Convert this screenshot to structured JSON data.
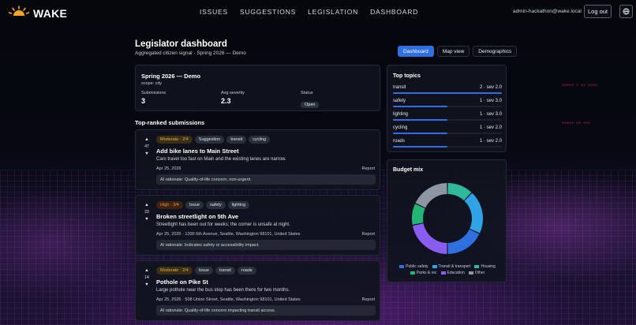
{
  "brand": {
    "name": "WAKE"
  },
  "nav": {
    "issues": "ISSUES",
    "suggestions": "SUGGESTIONS",
    "legislation": "LEGISLATION",
    "dashboard": "DASHBOARD"
  },
  "user": {
    "email": "admin-hackathon@wake.local",
    "logout_label": "Log out"
  },
  "page": {
    "title": "Legislator dashboard",
    "subtitle": "Aggregated citizen signal · Spring 2026 — Demo"
  },
  "view_tabs": [
    "Dashboard",
    "Map view",
    "Demographics"
  ],
  "active_tab": "Dashboard",
  "summary": {
    "title": "Spring 2026 — Demo",
    "scope": "scope: city",
    "submissions_label": "Submissions",
    "submissions_value": "3",
    "severity_label": "Avg severity",
    "severity_value": "2.3",
    "status_label": "Status",
    "status_value": "Open"
  },
  "submissions_title": "Top-ranked submissions",
  "submissions": [
    {
      "votes": "47",
      "severity": "Moderate · 2/4",
      "severity_level": "moderate",
      "tags": [
        "Suggestion",
        "transit",
        "cycling"
      ],
      "title": "Add bike lanes to Main Street",
      "description": "Cars travel too fast on Main and the existing lanes are narrow.",
      "meta": "Apr 25, 2026",
      "report_label": "Report",
      "rationale": "AI rationale: Quality-of-life concern, non-urgent."
    },
    {
      "votes": "23",
      "severity": "High · 3/4",
      "severity_level": "high",
      "tags": [
        "Issue",
        "safety",
        "lighting"
      ],
      "title": "Broken streetlight on 5th Ave",
      "description": "Streetlight has been out for weeks; the corner is unsafe at night.",
      "meta": "Apr 25, 2026 · 1200 6th Avenue, Seattle, Washington 98101, United States",
      "report_label": "Report",
      "rationale": "AI rationale: Indicates safety or accessibility impact."
    },
    {
      "votes": "14",
      "severity": "Moderate · 2/4",
      "severity_level": "moderate",
      "tags": [
        "Issue",
        "transit",
        "roads"
      ],
      "title": "Pothole on Pike St",
      "description": "Large pothole near the bus stop has been there for two months.",
      "meta": "Apr 25, 2026 · 508 Union Street, Seattle, Washington 98101, United States",
      "report_label": "Report",
      "rationale": "AI rationale: Quality-of-life concern impacting transit access."
    }
  ],
  "topics": {
    "title": "Top topics",
    "items": [
      {
        "name": "transit",
        "stat": "2 · sev 2.0",
        "share": 1.0
      },
      {
        "name": "safety",
        "stat": "1 · sev 3.0",
        "share": 0.5
      },
      {
        "name": "lighting",
        "stat": "1 · sev 3.0",
        "share": 0.5
      },
      {
        "name": "cycling",
        "stat": "1 · sev 2.0",
        "share": 0.5
      },
      {
        "name": "roads",
        "stat": "1 · sev 2.0",
        "share": 0.5
      }
    ]
  },
  "budget": {
    "title": "Budget mix",
    "slices": [
      {
        "name": "Public safety",
        "value": 18,
        "color": "#2f6fe0"
      },
      {
        "name": "Transit & transport",
        "value": 20,
        "color": "#2ea3e6"
      },
      {
        "name": "Housing",
        "value": 12,
        "color": "#2fb89a"
      },
      {
        "name": "Parks & rec",
        "value": 10,
        "color": "#22b573"
      },
      {
        "name": "Education",
        "value": 22,
        "color": "#8a5cf0"
      },
      {
        "name": "Other",
        "value": 18,
        "color": "#8e96a4"
      }
    ],
    "slice_order": [
      2,
      1,
      0,
      4,
      3,
      5
    ]
  },
  "colors": {
    "accent": "#2f6fe0",
    "sun": "#f5a623"
  }
}
